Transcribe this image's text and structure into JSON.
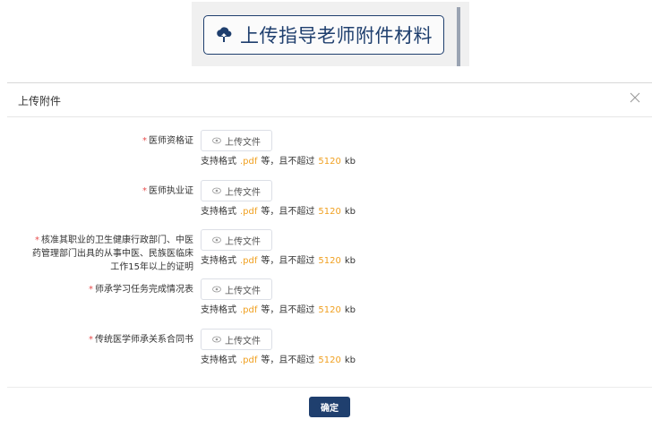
{
  "banner": {
    "label": "上传指导老师附件材料",
    "icon": "cloud-upload-icon"
  },
  "dialog": {
    "title": "上传附件",
    "close_icon": "close-icon",
    "hint": {
      "prefix": "支持格式",
      "format": ".pdf",
      "middle": "等，且不超过",
      "size": "5120",
      "unit": "kb"
    },
    "fields": [
      {
        "label": "医师资格证",
        "button": "上传文件"
      },
      {
        "label": "医师执业证",
        "button": "上传文件"
      },
      {
        "label_lines": [
          "核准其职业的卫生健康行政部门、中医",
          "药管理部门出具的从事中医、民族医临床",
          "工作15年以上的证明"
        ],
        "button": "上传文件"
      },
      {
        "label": "师承学习任务完成情况表",
        "button": "上传文件"
      },
      {
        "label": "传统医学师承关系合同书",
        "button": "上传文件"
      }
    ],
    "ok_label": "确定"
  },
  "colors": {
    "primary": "#1f3f6e",
    "required": "#e84e4e",
    "accent": "#f0a020"
  }
}
